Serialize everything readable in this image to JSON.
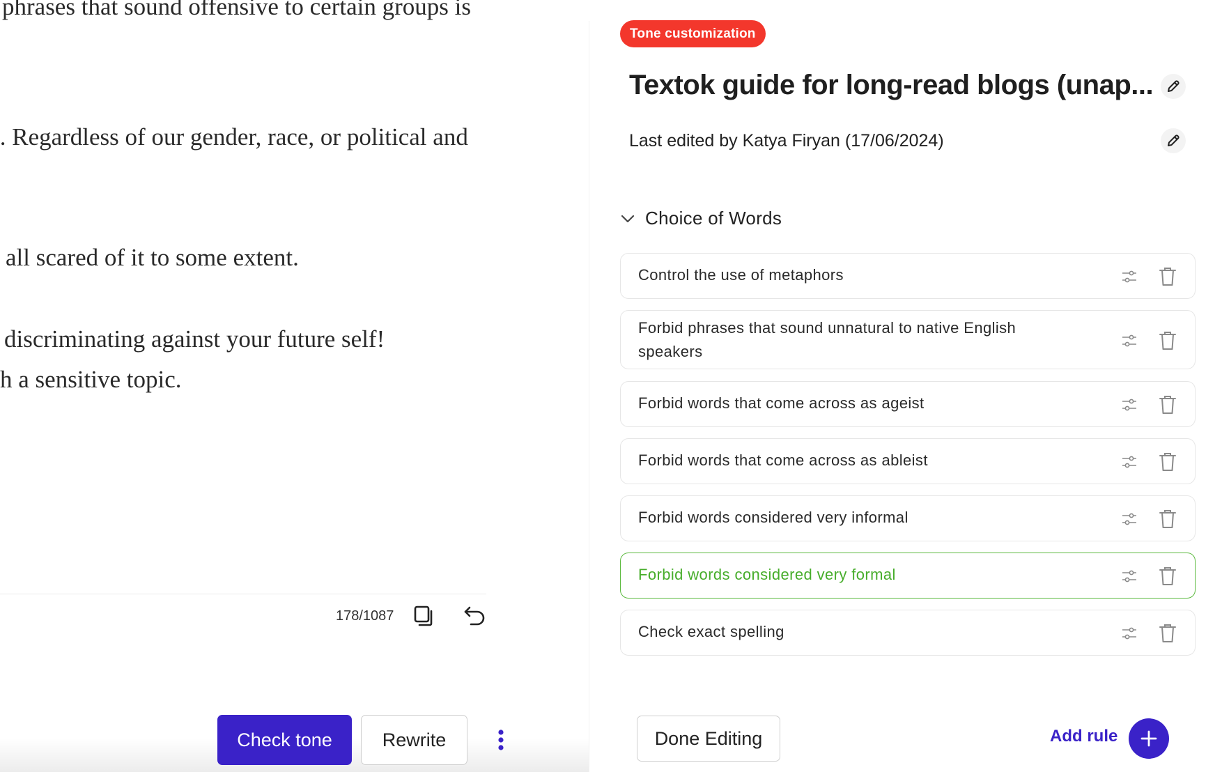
{
  "editor": {
    "lines": [
      "phrases that sound offensive to certain groups is",
      "t. Regardless of our gender, race, or political and",
      "all scared of it to some extent.",
      "discriminating against your future self!",
      "h a sensitive topic."
    ],
    "char_count": "178/1087",
    "copy_icon": "copy-icon",
    "undo_icon": "undo-icon"
  },
  "actions": {
    "check_tone_label": "Check tone",
    "rewrite_label": "Rewrite",
    "more_icon": "more-vertical-icon"
  },
  "panel": {
    "badge": "Tone customization",
    "title": "Textok guide for long-read blogs (unap...",
    "last_edited": "Last edited by Katya Firyan (17/06/2024)",
    "section": {
      "title": "Choice of Words",
      "expanded": true,
      "rules": [
        {
          "label": "Control the use of metaphors",
          "active": false
        },
        {
          "label": "Forbid phrases that sound unnatural to native English speakers",
          "active": false
        },
        {
          "label": "Forbid words that come across as ageist",
          "active": false
        },
        {
          "label": "Forbid words that come across as ableist",
          "active": false
        },
        {
          "label": "Forbid words considered very informal",
          "active": false
        },
        {
          "label": "Forbid words considered very formal",
          "active": true
        },
        {
          "label": "Check exact spelling",
          "active": false
        }
      ]
    },
    "done_editing_label": "Done Editing",
    "add_rule_label": "Add rule"
  },
  "colors": {
    "primary": "#3a22c8",
    "badge": "#f3372c",
    "active_rule": "#47ad2b",
    "rule_border": "#e6e6e6"
  }
}
